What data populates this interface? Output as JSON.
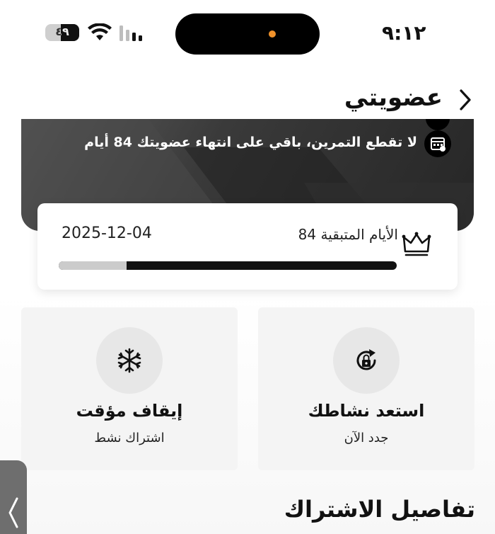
{
  "status_bar": {
    "time": "٩:١٢",
    "battery": "٤٩"
  },
  "header": {
    "title": "عضويتي",
    "back_icon": "chevron-right-icon"
  },
  "banner": {
    "message": "لا تقطع التمرين، باقي على انتهاء عضويتك  84 أيام",
    "icon": "calendar-icon"
  },
  "membership": {
    "remaining_label": "الأيام المتبقية 84",
    "end_date": "2025-12-04",
    "progress_remaining_fraction": 0.8,
    "icon": "crown-icon"
  },
  "actions": {
    "pause": {
      "title": "إيقاف مؤقت",
      "subtitle": "اشتراك نشط",
      "icon": "snowflake-icon"
    },
    "restore": {
      "title": "استعد نشاطك",
      "subtitle": "جدد الآن",
      "icon": "refresh-lock-icon"
    }
  },
  "sections": {
    "subscription_details": "تفاصيل الاشتراك"
  },
  "colors": {
    "accent_dot": "#f0922b",
    "banner_dark": "#2b2b2b",
    "card_bg": "#f4f4f4"
  }
}
